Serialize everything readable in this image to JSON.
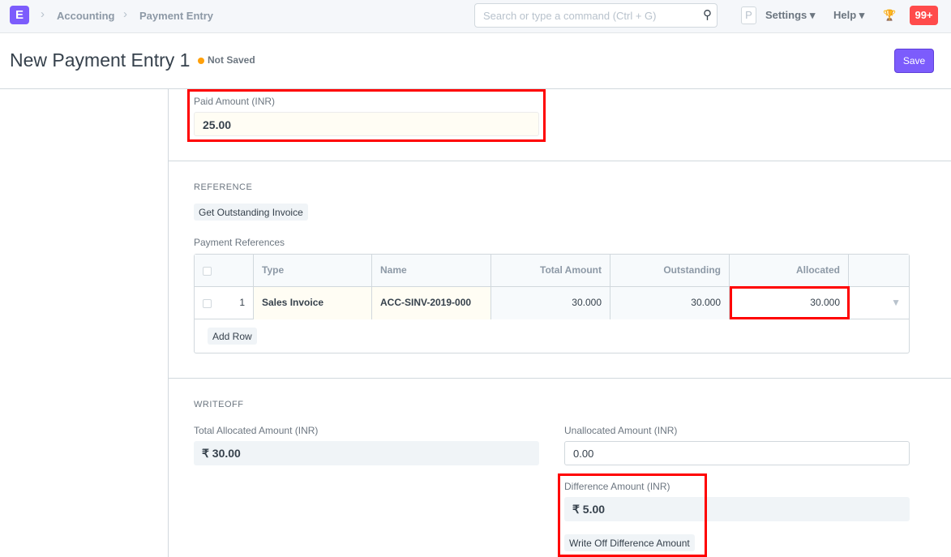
{
  "nav": {
    "logo": "E",
    "breadcrumbs": [
      "Accounting",
      "Payment Entry"
    ],
    "search_placeholder": "Search or type a command (Ctrl + G)",
    "avatar": "P",
    "settings": "Settings",
    "help": "Help",
    "notifications": "99+"
  },
  "page": {
    "title": "New Payment Entry 1",
    "status": "Not Saved",
    "save_label": "Save"
  },
  "paid": {
    "label": "Paid Amount (INR)",
    "value": "25.00"
  },
  "reference": {
    "section": "REFERENCE",
    "get_outstanding": "Get Outstanding Invoice",
    "table_label": "Payment References",
    "columns": [
      "Type",
      "Name",
      "Total Amount",
      "Outstanding",
      "Allocated"
    ],
    "rows": [
      {
        "idx": "1",
        "type": "Sales Invoice",
        "name": "ACC-SINV-2019-000",
        "total": "30.000",
        "outstanding": "30.000",
        "allocated": "30.000"
      }
    ],
    "add_row": "Add Row"
  },
  "writeoff": {
    "section": "WRITEOFF",
    "total_allocated_label": "Total Allocated Amount (INR)",
    "total_allocated": "₹ 30.00",
    "unallocated_label": "Unallocated Amount (INR)",
    "unallocated": "0.00",
    "difference_label": "Difference Amount (INR)",
    "difference": "₹ 5.00",
    "write_off_button": "Write Off Difference Amount"
  },
  "colors": {
    "accent": "#7c5cfc",
    "highlight": "#ff0000",
    "badge": "#ff4b4b"
  }
}
